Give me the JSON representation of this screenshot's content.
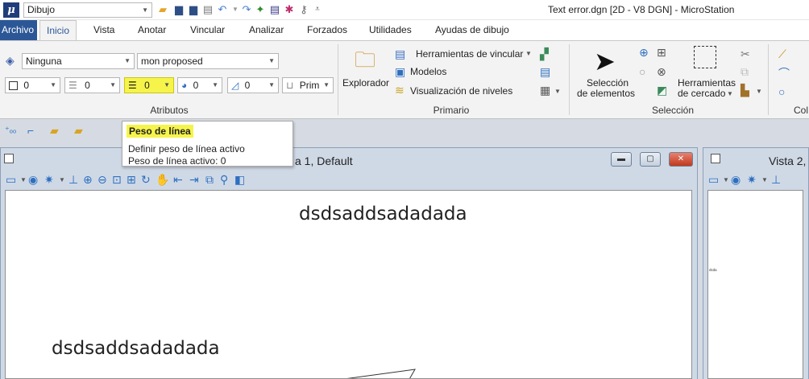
{
  "titlebar": {
    "workflow": "Dibujo",
    "window_title": "Text error.dgn [2D - V8 DGN] - MicroStation"
  },
  "tabs": [
    "Archivo",
    "Inicio",
    "Vista",
    "Anotar",
    "Vincular",
    "Analizar",
    "Forzados",
    "Utilidades",
    "Ayudas de dibujo"
  ],
  "attributes": {
    "level": "Ninguna",
    "text_style": "mon proposed",
    "color": "0",
    "line_style": "0",
    "line_weight": "0",
    "class_value": "0",
    "transparency": "0",
    "priority_label": "Prim",
    "group_label": "Atributos"
  },
  "primario": {
    "explorador": "Explorador",
    "herramientas_vincular": "Herramientas de vincular",
    "modelos": "Modelos",
    "visualizacion_niveles": "Visualización de niveles",
    "group_label": "Primario"
  },
  "seleccion": {
    "seleccion_line1": "Selección",
    "seleccion_line2": "de elementos",
    "cercado_line1": "Herramientas",
    "cercado_line2": "de cercado",
    "group_label": "Selección",
    "next_group_partial": "Col"
  },
  "tooltip": {
    "title": "Peso de línea",
    "line1": "Definir peso de línea activo",
    "line2": "Peso de línea activo: 0"
  },
  "views": {
    "view1_title": "a 1, Default",
    "view2_title": "Vista 2,"
  },
  "canvas": {
    "text1": "dsdsaddsadadada",
    "text2": "dsdsaddsadadada",
    "view2_text": "dsda"
  },
  "colors": {
    "accent": "#2b5797",
    "highlight": "#f6f44a",
    "close": "#c0391e"
  }
}
